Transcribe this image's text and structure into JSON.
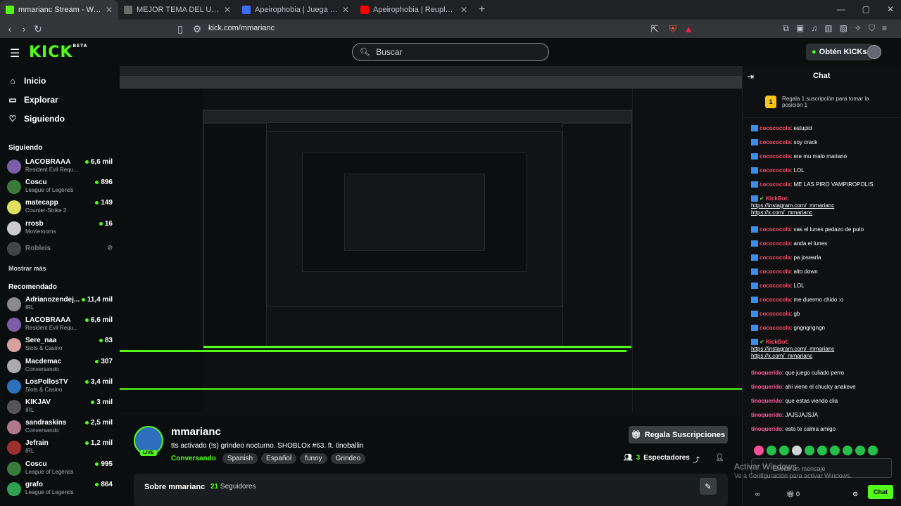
{
  "browser": {
    "tabs": [
      {
        "title": "mmarianc Stream - Watch Live",
        "color": "#53fc18"
      },
      {
        "title": "MEJOR TEMA DEL UNDER ARG Brack",
        "color": "#6b6b6b"
      },
      {
        "title": "Apeirophobia | Juega en Roblox",
        "color": "#3d6df5"
      },
      {
        "title": "Apeirophobia | Reuploaded old Teas",
        "color": "#ff0000"
      }
    ],
    "url": "kick.com/mmarianc"
  },
  "header": {
    "logo": "KICK",
    "beta": "BETA",
    "search_placeholder": "Buscar",
    "kicks_button": "Obtén KICKs"
  },
  "sidebar": {
    "nav": [
      {
        "label": "Inicio",
        "icon": "home-icon"
      },
      {
        "label": "Explorar",
        "icon": "browse-icon"
      },
      {
        "label": "Siguiendo",
        "icon": "heart-icon"
      }
    ],
    "following_title": "Siguiendo",
    "following": [
      {
        "name": "LACOBRAAA",
        "category": "Resident Evil Requ...",
        "viewers": "6,6 mil",
        "color": "#7b5ea7"
      },
      {
        "name": "Coscu",
        "category": "League of Legends",
        "viewers": "896",
        "color": "#3a7a3a"
      },
      {
        "name": "matecapp",
        "category": "Counter-Strike 2",
        "viewers": "149",
        "color": "#e0e060"
      },
      {
        "name": "rrosb",
        "category": "Movierooms",
        "viewers": "16",
        "color": "#cccccc"
      }
    ],
    "offline": {
      "name": "Robleis",
      "color": "#888888"
    },
    "show_more": "Mostrar más",
    "recommended_title": "Recomendado",
    "recommended": [
      {
        "name": "Adrianozendej...",
        "category": "IRL",
        "viewers": "11,4 mil",
        "color": "#8a8a8a"
      },
      {
        "name": "LACOBRAAA",
        "category": "Resident Evil Requ...",
        "viewers": "6,6 mil",
        "color": "#7b5ea7"
      },
      {
        "name": "Sere_naa",
        "category": "Slots & Casino",
        "viewers": "83",
        "color": "#d9a0a0"
      },
      {
        "name": "Macdemac",
        "category": "Conversando",
        "viewers": "307",
        "color": "#aaaaaa"
      },
      {
        "name": "LosPollosTV",
        "category": "Slots & Casino",
        "viewers": "3,4 mil",
        "color": "#2e6fbe"
      },
      {
        "name": "KIKJAV",
        "category": "IRL",
        "viewers": "3 mil",
        "color": "#555555"
      },
      {
        "name": "sandraskins",
        "category": "Conversando",
        "viewers": "2,5 mil",
        "color": "#b07a8a"
      },
      {
        "name": "Jefrain",
        "category": "IRL",
        "viewers": "1,2 mil",
        "color": "#a03030"
      },
      {
        "name": "Coscu",
        "category": "League of Legends",
        "viewers": "995",
        "color": "#3a7a3a"
      },
      {
        "name": "grafo",
        "category": "League of Legends",
        "viewers": "864",
        "color": "#30a050"
      }
    ]
  },
  "stream": {
    "streamer": "mmarianc",
    "live_badge": "LIVE",
    "title": "tts activado (!s) grindeo nocturno. SHOBLOx #63. ft. tinoballin",
    "category": "Conversando",
    "tags": [
      "Spanish",
      "Español",
      "funny",
      "Grindeo"
    ],
    "subscribe_button": "Regala Suscripciones",
    "viewers": "3",
    "viewers_label": "Espectadores",
    "about_title": "Sobre mmarianc",
    "followers_count": "21",
    "followers_label": "Seguidores"
  },
  "chat": {
    "title": "Chat",
    "pinned": {
      "number": "1",
      "text": "Regala 1 suscripción para tomar la posición 1"
    },
    "messages": [
      {
        "user": "cocococola",
        "text": "estupid"
      },
      {
        "user": "cocococola",
        "text": "soy crack"
      },
      {
        "user": "cocococola",
        "text": "ere mu malo mariano"
      },
      {
        "user": "cocococola",
        "text": "LOL"
      },
      {
        "user": "cocococola",
        "text": "ME LAS PIRO VAMPIROPOLIS"
      },
      {
        "user": "KickBot",
        "text": "",
        "links": [
          "https://instagram.com/_mmarianc",
          "https://x.com/_mmarianc"
        ]
      },
      {
        "user": "cocococola",
        "text": "vas el lunes pedazo de puto"
      },
      {
        "user": "cocococola",
        "text": "anda el lunes"
      },
      {
        "user": "cocococola",
        "text": "pa josearla"
      },
      {
        "user": "cocococola",
        "text": "alto down"
      },
      {
        "user": "cocococola",
        "text": "LOL"
      },
      {
        "user": "cocococola",
        "text": "me duermo chido :o"
      },
      {
        "user": "cocococola",
        "text": "gb"
      },
      {
        "user": "cocococola",
        "text": "gngngngngn"
      },
      {
        "user": "KickBot",
        "text": "",
        "links": [
          "https://instagram.com/_mmarianc",
          "https://x.com/_mmarianc"
        ]
      },
      {
        "user": "tinoquerido",
        "text": "que juego culiado perro"
      },
      {
        "user": "tinoquerido",
        "text": "ahi viene el chucky anakeve"
      },
      {
        "user": "tinoquerido",
        "text": "que estas viendo clia"
      },
      {
        "user": "tinoquerido",
        "text": "JAJSJAJSJA"
      },
      {
        "user": "tinoquerido",
        "text": "esto te calma amigo"
      }
    ],
    "input_placeholder": "Enviar un mensaje",
    "windows_watermark": "Activar Windows",
    "windows_sub": "Ve a Configuración para activar Windows.",
    "kicks_count": "0",
    "chat_button": "Chat"
  },
  "colors": {
    "accent": "#53fc18",
    "bg": "#0b0e0f"
  }
}
